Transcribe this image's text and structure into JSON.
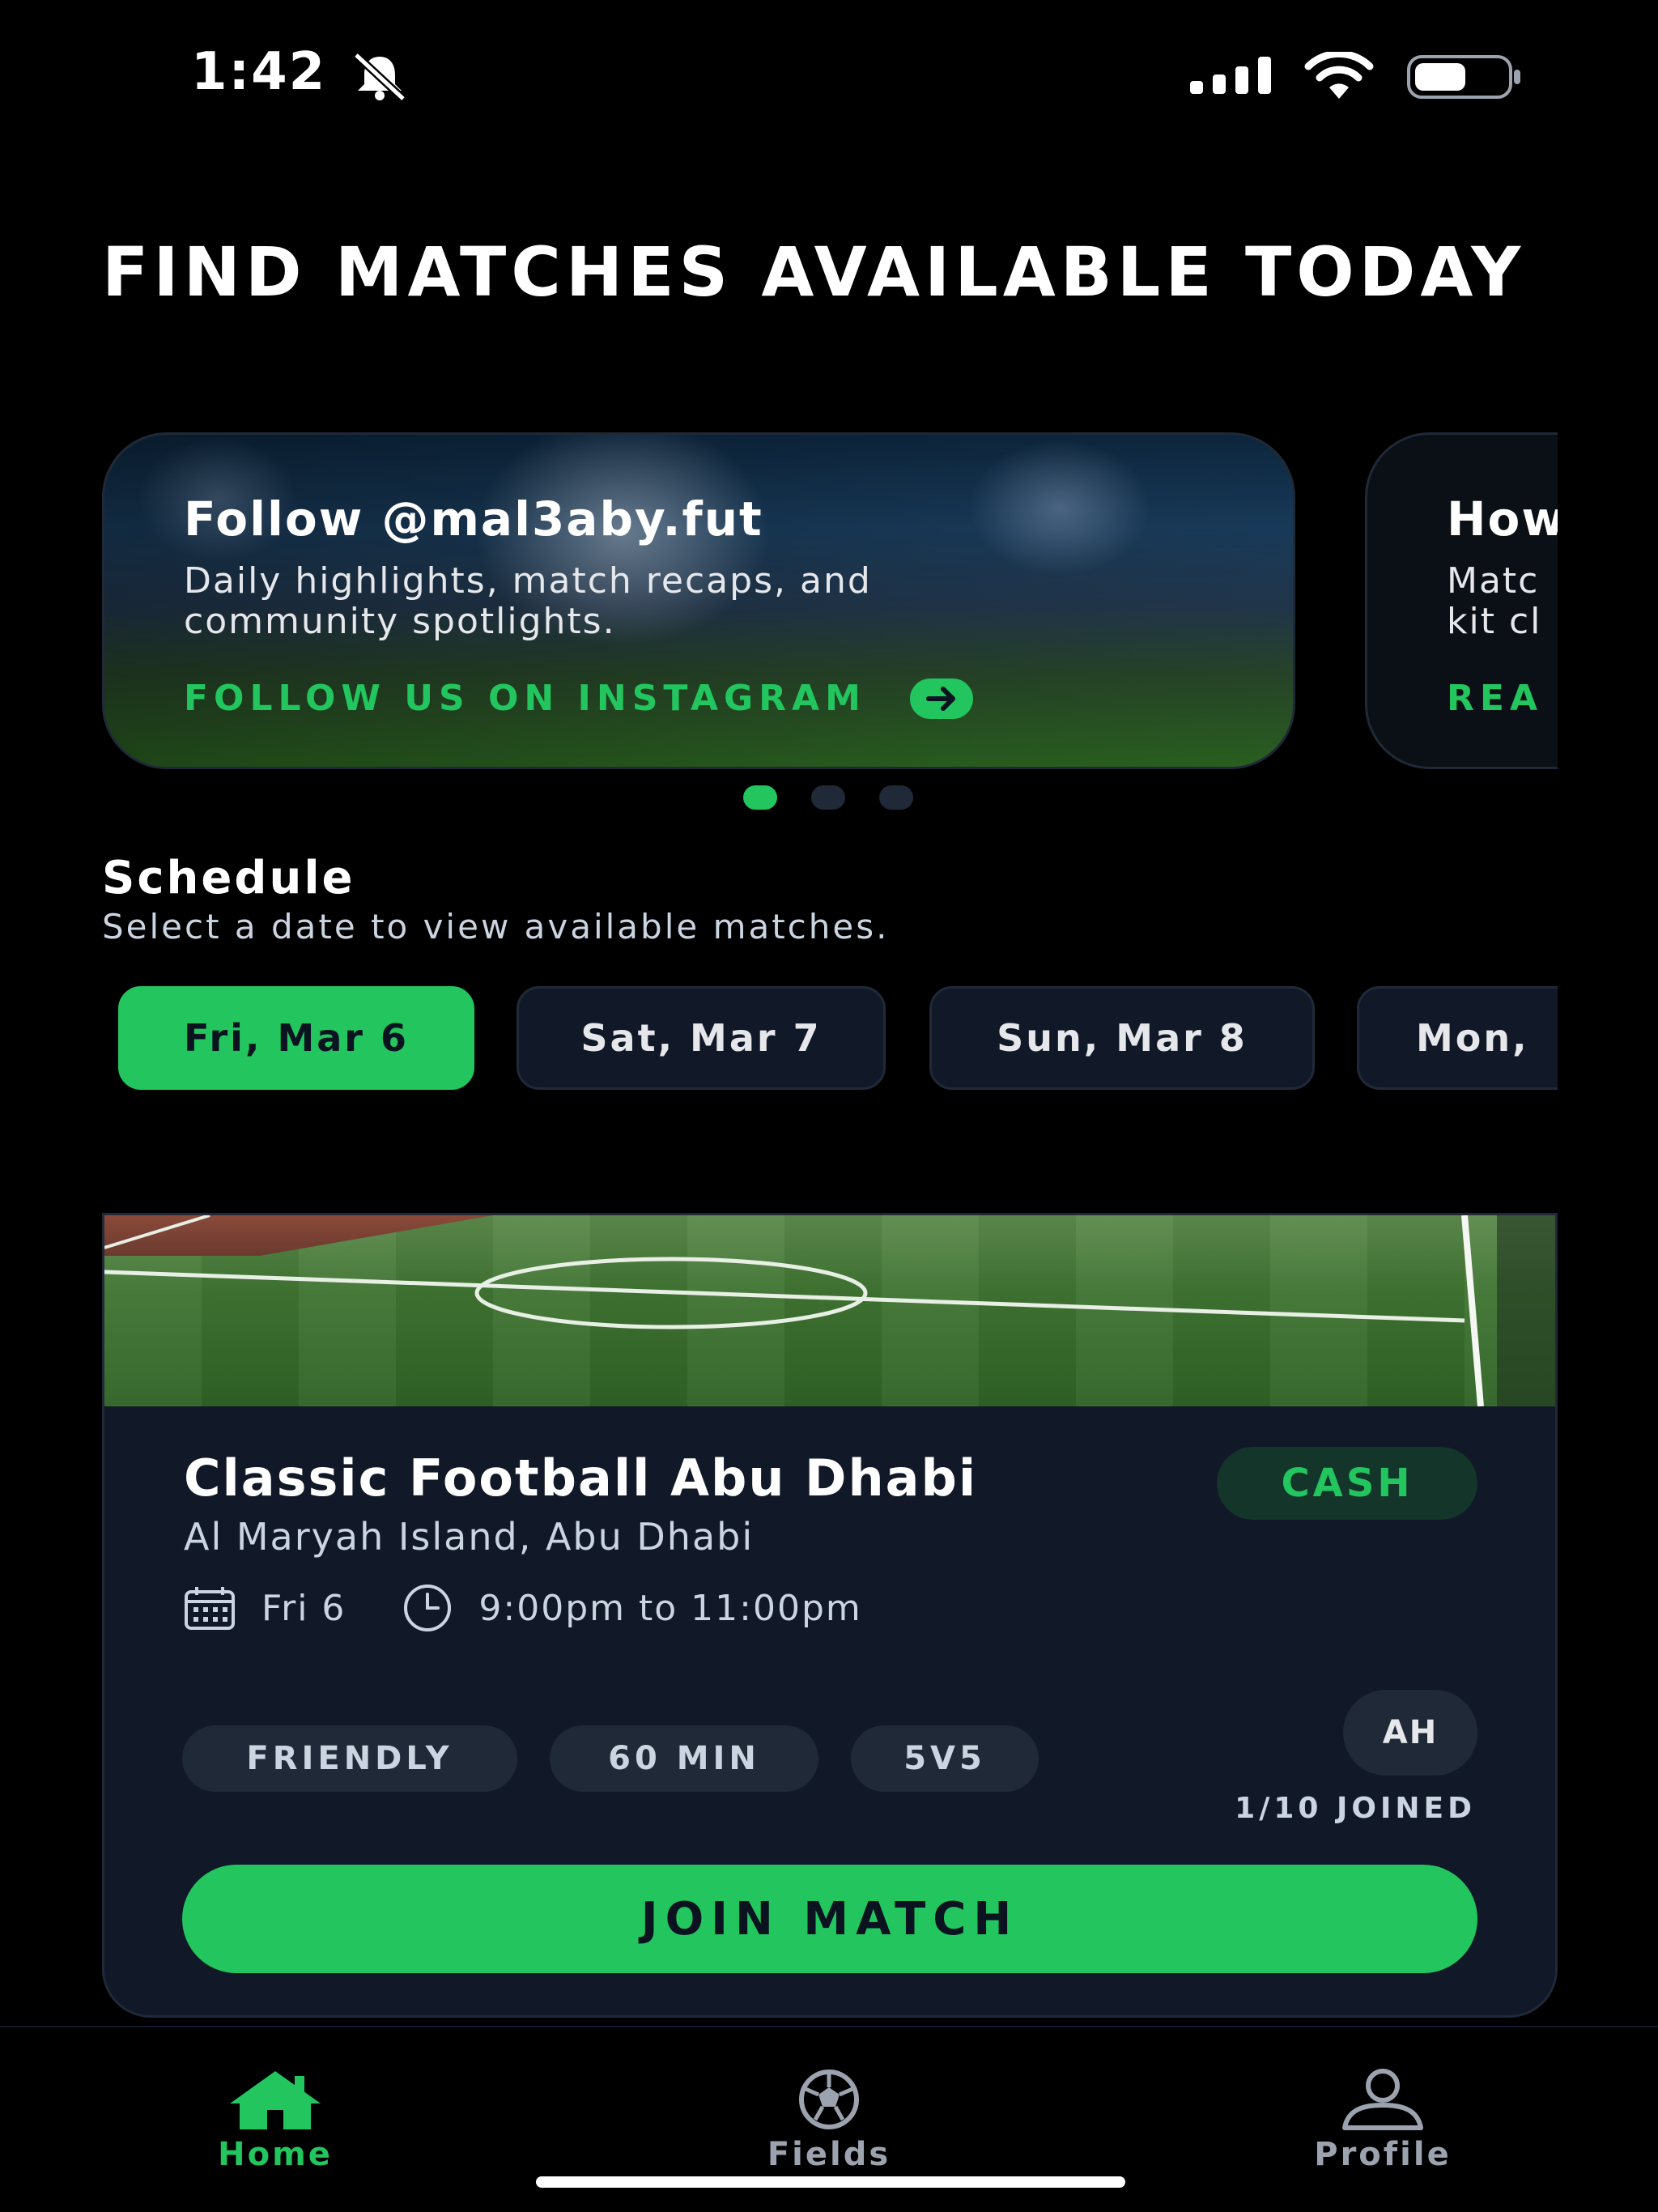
{
  "status_bar": {
    "time": "1:42"
  },
  "hero": {
    "title": "FIND MATCHES AVAILABLE TODAY"
  },
  "promos": [
    {
      "title": "Follow @mal3aby.fut",
      "description": "Daily highlights, match recaps, and\ncommunity spotlights.",
      "cta": "FOLLOW US ON INSTAGRAM"
    },
    {
      "title": "How",
      "description": "Matc\nkit cl",
      "cta": "REA"
    }
  ],
  "carousel": {
    "page_count": 3,
    "active_index": 0
  },
  "schedule": {
    "title": "Schedule",
    "subtitle": "Select a date to view available matches.",
    "dates": [
      {
        "label": "Fri, Mar 6",
        "selected": true
      },
      {
        "label": "Sat, Mar 7",
        "selected": false
      },
      {
        "label": "Sun, Mar 8",
        "selected": false
      },
      {
        "label": "Mon,",
        "selected": false
      }
    ]
  },
  "match": {
    "title": "Classic Football Abu Dhabi",
    "location": "Al Maryah Island, Abu Dhabi",
    "payment": "CASH",
    "date": "Fri 6",
    "time": "9:00pm to 11:00pm",
    "tags": [
      "FRIENDLY",
      "60 MIN",
      "5V5"
    ],
    "avatar_initials": "AH",
    "joined": "1/10 JOINED",
    "join_label": "JOIN MATCH"
  },
  "nav": {
    "items": [
      {
        "label": "Home",
        "icon": "home-icon",
        "active": true
      },
      {
        "label": "Fields",
        "icon": "soccer-ball-icon",
        "active": false
      },
      {
        "label": "Profile",
        "icon": "person-icon",
        "active": false
      }
    ]
  },
  "colors": {
    "accent": "#22c55e",
    "background": "#000000",
    "card": "#111827"
  }
}
